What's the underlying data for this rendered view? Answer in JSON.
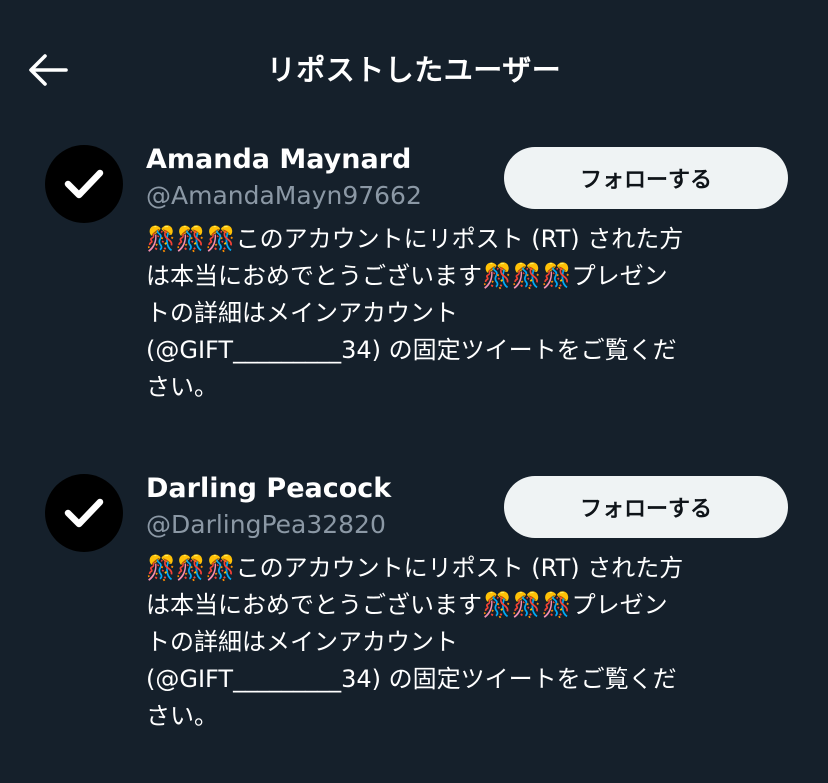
{
  "header": {
    "title": "リポストしたユーザー",
    "back_icon": "arrow-left-icon"
  },
  "users": [
    {
      "display_name": "Amanda Maynard",
      "handle": "@AmandaMayn97662",
      "follow_label": "フォローする",
      "avatar_icon": "checkmark-icon",
      "bio_lines": [
        "🎊🎊🎊このアカウントにリポスト (RT) された方",
        "は本当におめでとうございます🎊🎊🎊プレゼン",
        "トの詳細はメインアカウント",
        "(@GIFT_________34) の固定ツイートをご覧くだ",
        "さい。"
      ]
    },
    {
      "display_name": "Darling Peacock",
      "handle": "@DarlingPea32820",
      "follow_label": "フォローする",
      "avatar_icon": "checkmark-icon",
      "bio_lines": [
        "🎊🎊🎊このアカウントにリポスト (RT) された方",
        "は本当におめでとうございます🎊🎊🎊プレゼン",
        "トの詳細はメインアカウント",
        "(@GIFT_________34) の固定ツイートをご覧くだ",
        "さい。"
      ]
    }
  ],
  "colors": {
    "background": "#15202b",
    "secondary_text": "#8b98a5",
    "button_bg": "#eff3f4",
    "button_text": "#0f1419"
  }
}
